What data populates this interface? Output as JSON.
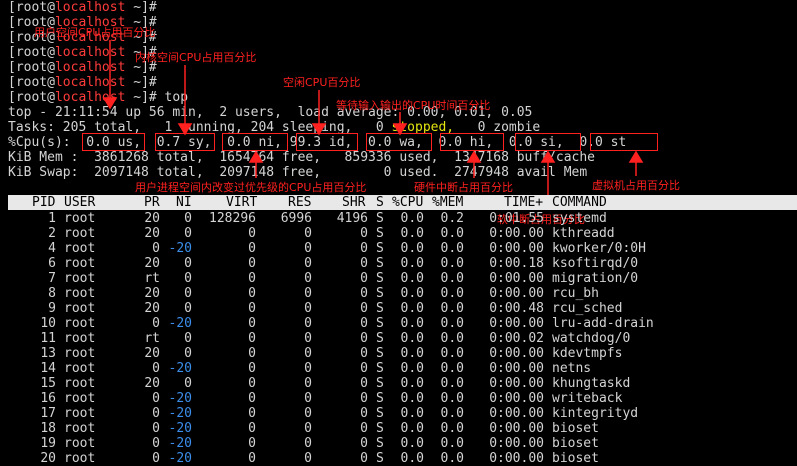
{
  "prompt_lines": [
    {
      "user": "[root@",
      "host": "localhost",
      "rest": " ~]#",
      "cmd": ""
    },
    {
      "user": "[root@",
      "host": "localhost",
      "rest": " ~]#",
      "cmd": ""
    },
    {
      "user": "[root@",
      "host": "localhost",
      "rest": " ~]#",
      "cmd": ""
    },
    {
      "user": "[root@",
      "host": "localhost",
      "rest": " ~]#",
      "cmd": ""
    },
    {
      "user": "[root@",
      "host": "localhost",
      "rest": " ~]#",
      "cmd": ""
    },
    {
      "user": "[root@",
      "host": "localhost",
      "rest": " ~]#",
      "cmd": ""
    },
    {
      "user": "[root@",
      "host": "localhost",
      "rest": " ~]#",
      "cmd": " top"
    }
  ],
  "summary": {
    "top_line": "top - 21:11:54 up 56 min,  2 users,  load average: 0.00, 0.01, 0.05",
    "tasks_prefix": "Tasks: 205 total,   1 running, 204 sleeping,   0 ",
    "tasks_stopped": "stopped,",
    "tasks_suffix": "   0 zombie",
    "cpu_line": "%Cpu(s):  0.0 us,  0.7 sy,  0.0 ni, 99.3 id,  0.0 wa,  0.0 hi,  0.0 si,  0.0 st",
    "mem_line": "KiB Mem :  3861268 total,  1654764 free,   859336 used,  1347168 buff/cache",
    "swap_line": "KiB Swap:  2097148 total,  2097148 free,        0 used.  2747948 avail Mem"
  },
  "annotations": {
    "us": "用户空间CPU占用百分比",
    "sy": "内核空间CPU占用百分比",
    "id": "空闲CPU百分比",
    "wa": "等待输入输出的CPU时间百分比",
    "ni": "用户进程空间内改变过优先级的CPU占用百分比",
    "hi": "硬件中断占用百分比",
    "si": "软中断占用百分比",
    "st": "虚拟机占用百分比"
  },
  "table": {
    "headers": [
      "PID",
      "USER",
      "PR",
      "NI",
      "VIRT",
      "RES",
      "SHR",
      "S",
      "%CPU",
      "%MEM",
      "TIME+",
      "COMMAND"
    ],
    "rows": [
      [
        "1",
        "root",
        "20",
        "0",
        "128296",
        "6996",
        "4196",
        "S",
        "0.0",
        "0.2",
        "0:01.55",
        "systemd"
      ],
      [
        "2",
        "root",
        "20",
        "0",
        "0",
        "0",
        "0",
        "S",
        "0.0",
        "0.0",
        "0:00.00",
        "kthreadd"
      ],
      [
        "4",
        "root",
        "0",
        "-20",
        "0",
        "0",
        "0",
        "S",
        "0.0",
        "0.0",
        "0:00.00",
        "kworker/0:0H"
      ],
      [
        "6",
        "root",
        "20",
        "0",
        "0",
        "0",
        "0",
        "S",
        "0.0",
        "0.0",
        "0:00.18",
        "ksoftirqd/0"
      ],
      [
        "7",
        "root",
        "rt",
        "0",
        "0",
        "0",
        "0",
        "S",
        "0.0",
        "0.0",
        "0:00.00",
        "migration/0"
      ],
      [
        "8",
        "root",
        "20",
        "0",
        "0",
        "0",
        "0",
        "S",
        "0.0",
        "0.0",
        "0:00.00",
        "rcu_bh"
      ],
      [
        "9",
        "root",
        "20",
        "0",
        "0",
        "0",
        "0",
        "S",
        "0.0",
        "0.0",
        "0:00.48",
        "rcu_sched"
      ],
      [
        "10",
        "root",
        "0",
        "-20",
        "0",
        "0",
        "0",
        "S",
        "0.0",
        "0.0",
        "0:00.00",
        "lru-add-drain"
      ],
      [
        "11",
        "root",
        "rt",
        "0",
        "0",
        "0",
        "0",
        "S",
        "0.0",
        "0.0",
        "0:00.02",
        "watchdog/0"
      ],
      [
        "13",
        "root",
        "20",
        "0",
        "0",
        "0",
        "0",
        "S",
        "0.0",
        "0.0",
        "0:00.00",
        "kdevtmpfs"
      ],
      [
        "14",
        "root",
        "0",
        "-20",
        "0",
        "0",
        "0",
        "S",
        "0.0",
        "0.0",
        "0:00.00",
        "netns"
      ],
      [
        "15",
        "root",
        "20",
        "0",
        "0",
        "0",
        "0",
        "S",
        "0.0",
        "0.0",
        "0:00.00",
        "khungtaskd"
      ],
      [
        "16",
        "root",
        "0",
        "-20",
        "0",
        "0",
        "0",
        "S",
        "0.0",
        "0.0",
        "0:00.00",
        "writeback"
      ],
      [
        "17",
        "root",
        "0",
        "-20",
        "0",
        "0",
        "0",
        "S",
        "0.0",
        "0.0",
        "0:00.00",
        "kintegrityd"
      ],
      [
        "18",
        "root",
        "0",
        "-20",
        "0",
        "0",
        "0",
        "S",
        "0.0",
        "0.0",
        "0:00.00",
        "bioset"
      ],
      [
        "19",
        "root",
        "0",
        "-20",
        "0",
        "0",
        "0",
        "S",
        "0.0",
        "0.0",
        "0:00.00",
        "bioset"
      ],
      [
        "20",
        "root",
        "0",
        "-20",
        "0",
        "0",
        "0",
        "S",
        "0.0",
        "0.0",
        "0:00.00",
        "bioset"
      ]
    ]
  },
  "colors": {
    "background": "#000000",
    "text": "#d4d4d4",
    "host": "#ff3b3b",
    "annotation": "#ff2020",
    "header_bg": "#e8e8e8",
    "negative_ni": "#3b8eea"
  }
}
